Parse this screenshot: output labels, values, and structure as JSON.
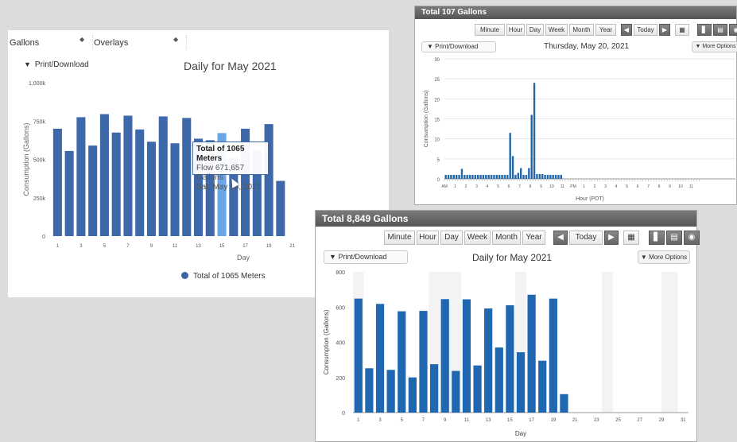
{
  "panel1": {
    "unit_select": "Gallons",
    "unit_select_icon": "select-arrows-icon",
    "overlays_select": "Overlays",
    "overlays_select_icon": "select-arrows-icon",
    "print_download": "Print/Download",
    "print_download_icon": "triangle-down-icon",
    "title": "Daily for May 2021",
    "y_tick_labels": [
      "0",
      "250k",
      "500k",
      "750k",
      "1,000k"
    ],
    "x_tick_labels": [
      "1",
      "3",
      "5",
      "7",
      "9",
      "11",
      "13",
      "15",
      "17",
      "19",
      "21"
    ],
    "xlabel": "Day",
    "ylabel": "Consumption (Gallons)",
    "legend_label": "Total of 1065 Meters",
    "legend_color": "#3a63a8",
    "tooltip": {
      "title": "Total of 1065 Meters",
      "flow": "Flow 671,657 Gallons",
      "date": "Sat, May 15, 2021"
    },
    "colors": {
      "bar": "#3d69ab",
      "highlight": "#6aa6e8"
    }
  },
  "panel2": {
    "header": "Total 107 Gallons",
    "buttons": [
      "Minute",
      "Hour",
      "Day",
      "Week",
      "Month",
      "Year",
      "Today"
    ],
    "selected": "Minute",
    "print_download": "Print/Download",
    "title": "Thursday, May 20, 2021",
    "more_options": "More Options",
    "y_tick_labels": [
      "0",
      "5",
      "10",
      "15",
      "20",
      "25",
      "30"
    ],
    "x_tick_labels": [
      "AM",
      "1",
      "2",
      "3",
      "4",
      "5",
      "6",
      "7",
      "8",
      "9",
      "10",
      "11",
      "PM",
      "1",
      "2",
      "3",
      "4",
      "5",
      "6",
      "7",
      "8",
      "9",
      "10",
      "11"
    ],
    "xlabel": "Hour (PDT)",
    "ylabel": "Consumption (Gallons)",
    "colors": {
      "bar": "#2066a8"
    }
  },
  "panel3": {
    "header": "Total 8,849 Gallons",
    "buttons": [
      "Minute",
      "Hour",
      "Day",
      "Week",
      "Month",
      "Year",
      "Today"
    ],
    "selected": "Day",
    "print_download": "Print/Download",
    "title": "Daily for May 2021",
    "more_options": "More Options",
    "y_tick_labels": [
      "0",
      "200",
      "400",
      "600",
      "800"
    ],
    "x_tick_labels": [
      "1",
      "3",
      "5",
      "7",
      "9",
      "11",
      "13",
      "15",
      "17",
      "19",
      "21",
      "23",
      "25",
      "27",
      "29",
      "31"
    ],
    "xlabel": "Day",
    "ylabel": "Consumption (Gallons)",
    "colors": {
      "bar": "#1f67b0",
      "band": "#f3f3f3"
    }
  },
  "chart_data": [
    {
      "type": "bar",
      "title": "Daily for May 2021",
      "xlabel": "Day",
      "ylabel": "Consumption (Gallons)",
      "ylim": [
        0,
        1000000
      ],
      "grid": false,
      "legend": "bottom",
      "x": [
        1,
        2,
        3,
        4,
        5,
        6,
        7,
        8,
        9,
        10,
        11,
        12,
        13,
        14,
        15,
        16,
        17,
        18,
        19,
        20
      ],
      "series": [
        {
          "name": "Total of 1065 Meters",
          "values": [
            700000,
            555000,
            775000,
            590000,
            795000,
            675000,
            785000,
            695000,
            615000,
            780000,
            605000,
            770000,
            635000,
            625000,
            671657,
            510000,
            700000,
            555000,
            730000,
            360000
          ]
        }
      ],
      "highlight_x": 15
    },
    {
      "type": "bar",
      "title": "Thursday, May 20, 2021",
      "xlabel": "Hour (PDT)",
      "ylabel": "Consumption (Gallons)",
      "ylim": [
        0,
        30
      ],
      "grid": true,
      "x": [
        0.25,
        0.5,
        0.75,
        1.0,
        1.25,
        1.5,
        1.75,
        2.0,
        2.25,
        2.5,
        2.75,
        3.0,
        3.25,
        3.5,
        3.75,
        4.0,
        4.25,
        4.5,
        4.75,
        5.0,
        5.25,
        5.5,
        5.75,
        6.0,
        6.25,
        6.5,
        6.75,
        7.0,
        7.25,
        7.5,
        7.75,
        8.0,
        8.25,
        8.5,
        8.75,
        9.0,
        9.25,
        9.5,
        9.75,
        10.0,
        10.25,
        10.5,
        10.75,
        11.0
      ],
      "series": [
        {
          "values": [
            1,
            1,
            1,
            1,
            1,
            1,
            2.5,
            1,
            1,
            1,
            1,
            1,
            1,
            1,
            1,
            1,
            1,
            1,
            1,
            1,
            1,
            1,
            1,
            1,
            11.5,
            5.7,
            1,
            1.5,
            2.7,
            1,
            1,
            2.7,
            16,
            24,
            1.2,
            1.2,
            1.2,
            1,
            1,
            1,
            1,
            1,
            1,
            1
          ]
        }
      ]
    },
    {
      "type": "bar",
      "title": "Daily for May 2021",
      "xlabel": "Day",
      "ylabel": "Consumption (Gallons)",
      "ylim": [
        0,
        800
      ],
      "grid": false,
      "x": [
        1,
        2,
        3,
        4,
        5,
        6,
        7,
        8,
        9,
        10,
        11,
        12,
        13,
        14,
        15,
        16,
        17,
        18,
        19,
        20
      ],
      "series": [
        {
          "values": [
            648,
            252,
            618,
            243,
            576,
            200,
            578,
            275,
            645,
            237,
            644,
            268,
            592,
            370,
            610,
            343,
            670,
            295,
            648,
            105
          ]
        }
      ]
    }
  ]
}
